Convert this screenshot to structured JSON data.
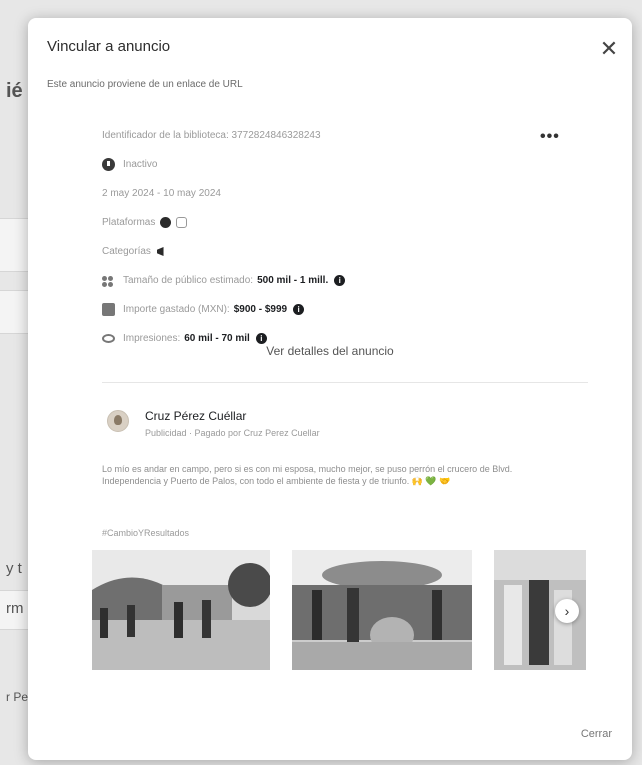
{
  "background": {
    "fragments": [
      "ié",
      "y t",
      "rm",
      "r Pe"
    ]
  },
  "dialog": {
    "title": "Vincular a anuncio",
    "close_label": "✕",
    "subtitle": "Este anuncio proviene de un enlace de URL",
    "more_label": "•••",
    "meta": {
      "library_id": "Identificador de la biblioteca: 3772824846328243",
      "status": "Inactivo",
      "dates": "2 may 2024 - 10 may 2024",
      "platforms_label": "Plataformas",
      "categories_label": "Categorías",
      "audience_label": "Tamaño de público estimado:",
      "audience_value": "500 mil - 1 mill.",
      "spend_label": "Importe gastado (MXN):",
      "spend_value": "$900 - $999",
      "impressions_label": "Impresiones:",
      "impressions_value": "60 mil - 70 mil"
    },
    "details_link": "Ver detalles del anuncio",
    "advertiser": {
      "name": "Cruz Pérez Cuéllar",
      "sub": "Publicidad · Pagado por Cruz Perez Cuellar"
    },
    "ad_body": "Lo mío es andar en campo, pero si es con mi esposa, mucho mejor, se puso perrón el crucero de Blvd. Independencia y Puerto de Palos, con todo el ambiente de fiesta y de triunfo. 🙌 💚 🤝",
    "hashtag": "#CambioYResultados",
    "next_label": "›",
    "close_button": "Cerrar"
  }
}
